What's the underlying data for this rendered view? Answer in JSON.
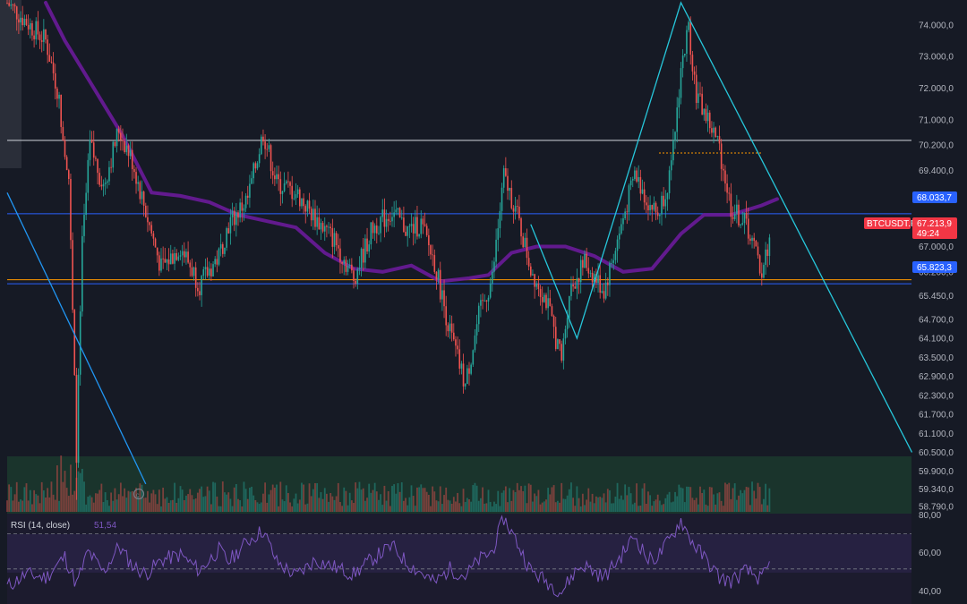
{
  "symbol": "BTCUSDT.P",
  "price_axis": {
    "ticks": [
      "74.000,0",
      "73.000,0",
      "72.000,0",
      "71.000,0",
      "70.200,0",
      "69.400,0",
      "68.600,0",
      "67.800,0",
      "67.000,0",
      "66.200,0",
      "65.450,0",
      "64.700,0",
      "64.100,0",
      "63.500,0",
      "62.900,0",
      "62.300,0",
      "61.700,0",
      "61.100,0",
      "60.500,0",
      "59.900,0",
      "59.340,0",
      "58.790,0"
    ]
  },
  "price_labels": {
    "resistance": {
      "text": "68.033,7",
      "color": "#2962ff"
    },
    "current": {
      "text": "67.213,9",
      "countdown": "49:24",
      "color": "#f23645"
    },
    "support": {
      "text": "65.823,3",
      "color": "#2962ff"
    }
  },
  "horizontal_lines": [
    {
      "name": "upper-level",
      "price": 70350,
      "color": "#d1d4dc"
    },
    {
      "name": "resistance-level",
      "price": 68033.7,
      "color": "#2962ff"
    },
    {
      "name": "orange-level",
      "price": 65950,
      "color": "#ff9800"
    },
    {
      "name": "support-level",
      "price": 65823.3,
      "color": "#2962ff"
    }
  ],
  "rsi": {
    "label": "RSI (14, close)",
    "value": "51,54",
    "ticks": [
      "80,00",
      "60,00",
      "40,00"
    ],
    "color": "#7e57c2"
  },
  "watermark_icon": "tradingview-c-logo",
  "chart_data": {
    "type": "candlestick",
    "title": "",
    "symbol": "BTCUSDT.P",
    "ylim": [
      58790,
      74700
    ],
    "price_path": [
      [
        0,
        74700
      ],
      [
        20,
        73500
      ],
      [
        26,
        72000
      ],
      [
        32,
        69200
      ],
      [
        36,
        60500
      ],
      [
        39,
        67000
      ],
      [
        43,
        70200
      ],
      [
        50,
        68900
      ],
      [
        58,
        70700
      ],
      [
        65,
        69700
      ],
      [
        72,
        68100
      ],
      [
        80,
        66300
      ],
      [
        90,
        67000
      ],
      [
        100,
        65800
      ],
      [
        110,
        66700
      ],
      [
        115,
        67700
      ],
      [
        125,
        68500
      ],
      [
        133,
        70600
      ],
      [
        140,
        69000
      ],
      [
        150,
        68700
      ],
      [
        160,
        67900
      ],
      [
        170,
        67200
      ],
      [
        180,
        66000
      ],
      [
        190,
        67600
      ],
      [
        200,
        68100
      ],
      [
        208,
        67500
      ],
      [
        215,
        67700
      ],
      [
        222,
        66500
      ],
      [
        230,
        64300
      ],
      [
        238,
        62600
      ],
      [
        245,
        64800
      ],
      [
        252,
        66000
      ],
      [
        258,
        69200
      ],
      [
        264,
        68200
      ],
      [
        272,
        66300
      ],
      [
        280,
        65300
      ],
      [
        288,
        63400
      ],
      [
        292,
        65600
      ],
      [
        300,
        66500
      ],
      [
        310,
        65600
      ],
      [
        318,
        67400
      ],
      [
        326,
        69300
      ],
      [
        333,
        68400
      ],
      [
        338,
        68000
      ],
      [
        345,
        69400
      ],
      [
        350,
        72600
      ],
      [
        354,
        73900
      ],
      [
        358,
        71800
      ],
      [
        364,
        71000
      ],
      [
        370,
        70100
      ],
      [
        376,
        68200
      ],
      [
        384,
        67700
      ],
      [
        392,
        66200
      ],
      [
        396,
        67200
      ]
    ],
    "moving_average": [
      [
        20,
        74700
      ],
      [
        30,
        73500
      ],
      [
        45,
        72000
      ],
      [
        60,
        70500
      ],
      [
        75,
        68700
      ],
      [
        90,
        68600
      ],
      [
        105,
        68400
      ],
      [
        120,
        68000
      ],
      [
        135,
        67800
      ],
      [
        150,
        67600
      ],
      [
        165,
        66800
      ],
      [
        180,
        66300
      ],
      [
        195,
        66200
      ],
      [
        210,
        66400
      ],
      [
        225,
        65900
      ],
      [
        240,
        66000
      ],
      [
        250,
        66100
      ],
      [
        262,
        66800
      ],
      [
        275,
        67000
      ],
      [
        290,
        67000
      ],
      [
        305,
        66700
      ],
      [
        320,
        66200
      ],
      [
        335,
        66300
      ],
      [
        350,
        67400
      ],
      [
        362,
        68000
      ],
      [
        376,
        68000
      ],
      [
        392,
        68300
      ],
      [
        400,
        68500
      ]
    ],
    "trend_lines": [
      [
        [
          0,
          68700
        ],
        [
          72,
          59500
        ]
      ],
      [
        [
          272,
          67700
        ],
        [
          296,
          64100
        ],
        [
          350,
          74700
        ],
        [
          470,
          60500
        ]
      ]
    ],
    "rsi_range": [
      30,
      80
    ],
    "rsi_levels": [
      70,
      50
    ],
    "rsi_path": [
      [
        0,
        40
      ],
      [
        10,
        47
      ],
      [
        20,
        45
      ],
      [
        30,
        57
      ],
      [
        36,
        41
      ],
      [
        42,
        60
      ],
      [
        50,
        48
      ],
      [
        58,
        63
      ],
      [
        65,
        52
      ],
      [
        72,
        47
      ],
      [
        80,
        55
      ],
      [
        90,
        58
      ],
      [
        100,
        49
      ],
      [
        110,
        61
      ],
      [
        115,
        54
      ],
      [
        125,
        66
      ],
      [
        133,
        72
      ],
      [
        140,
        54
      ],
      [
        150,
        46
      ],
      [
        160,
        55
      ],
      [
        170,
        51
      ],
      [
        180,
        47
      ],
      [
        190,
        56
      ],
      [
        200,
        63
      ],
      [
        208,
        53
      ],
      [
        215,
        48
      ],
      [
        222,
        42
      ],
      [
        230,
        50
      ],
      [
        238,
        46
      ],
      [
        245,
        55
      ],
      [
        252,
        60
      ],
      [
        258,
        79
      ],
      [
        264,
        67
      ],
      [
        272,
        49
      ],
      [
        280,
        43
      ],
      [
        288,
        37
      ],
      [
        296,
        50
      ],
      [
        300,
        52
      ],
      [
        310,
        45
      ],
      [
        318,
        56
      ],
      [
        326,
        69
      ],
      [
        333,
        55
      ],
      [
        338,
        57
      ],
      [
        345,
        68
      ],
      [
        350,
        78
      ],
      [
        354,
        69
      ],
      [
        358,
        62
      ],
      [
        364,
        54
      ],
      [
        370,
        45
      ],
      [
        376,
        43
      ],
      [
        384,
        49
      ],
      [
        392,
        44
      ],
      [
        396,
        52
      ]
    ]
  }
}
